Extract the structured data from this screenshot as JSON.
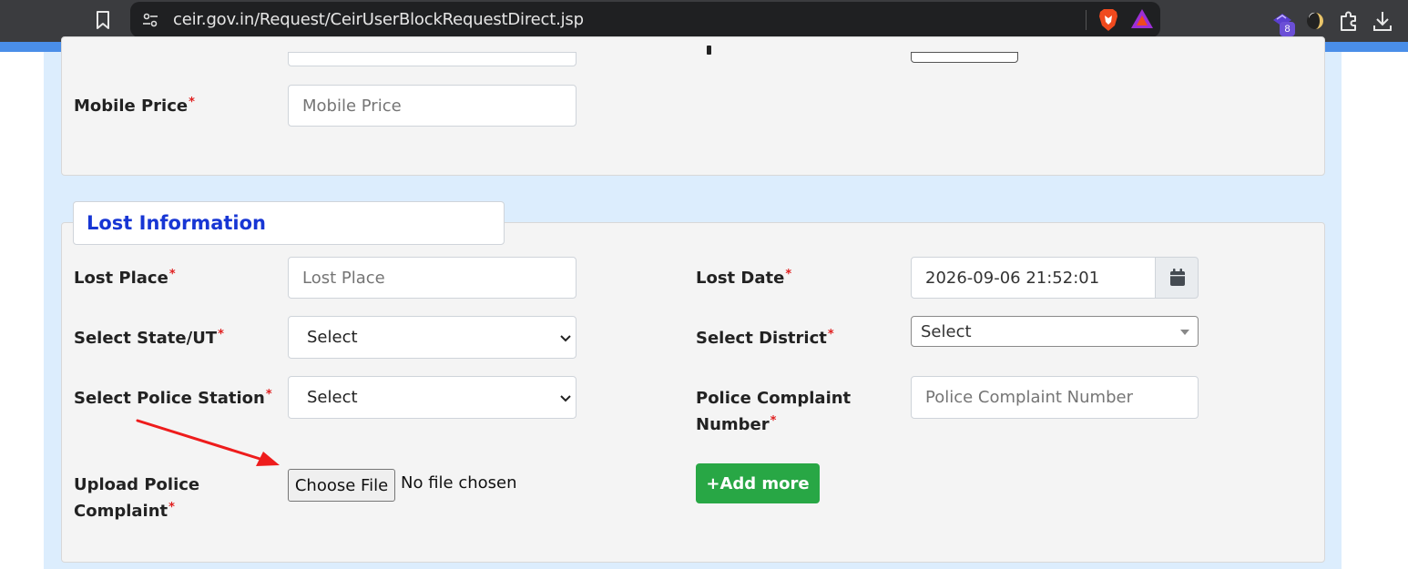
{
  "browser": {
    "url": "ceir.gov.in/Request/CeirUserBlockRequestDirect.jsp",
    "extension_badge": "8",
    "icons": [
      "bookmark-icon",
      "site-settings-icon",
      "brave-shields-icon",
      "brave-rewards-icon",
      "wallet-extension-icon",
      "extension-icon",
      "puzzle-icon",
      "download-icon"
    ]
  },
  "device_section": {
    "mobile_price": {
      "label": "Mobile Price",
      "required_mark": "*",
      "placeholder": "Mobile Price",
      "value": ""
    }
  },
  "lost_information": {
    "legend": "Lost Information",
    "lost_place": {
      "label": "Lost Place",
      "required_mark": "*",
      "placeholder": "Lost Place",
      "value": ""
    },
    "lost_date": {
      "label": "Lost Date",
      "required_mark": "*",
      "value": "2026-09-06 21:52:01",
      "button_icon": "calendar-icon"
    },
    "state": {
      "label": "Select State/UT",
      "required_mark": "*",
      "selected": "Select"
    },
    "district": {
      "label": "Select District",
      "required_mark": "*",
      "selected": "Select"
    },
    "police_station": {
      "label": "Select Police Station",
      "required_mark": "*",
      "selected": "Select"
    },
    "complaint_number": {
      "label_line1": "Police Complaint",
      "label_line2": "Number",
      "required_mark": "*",
      "placeholder": "Police Complaint Number",
      "value": ""
    },
    "upload": {
      "label_line1": "Upload Police",
      "label_line2": "Complaint",
      "required_mark": "*",
      "button_label": "Choose File",
      "status": "No file chosen"
    },
    "add_more_label": "+Add more"
  },
  "colors": {
    "chrome_bg": "#3b3c3f",
    "urlbar_bg": "#1f2022",
    "page_bg": "#dcedfd",
    "panel_bg": "#f4f4f4",
    "legend_text": "#1736d4",
    "required": "#e02020",
    "add_button": "#28a745",
    "annotation_arrow": "#ee1c1c"
  }
}
